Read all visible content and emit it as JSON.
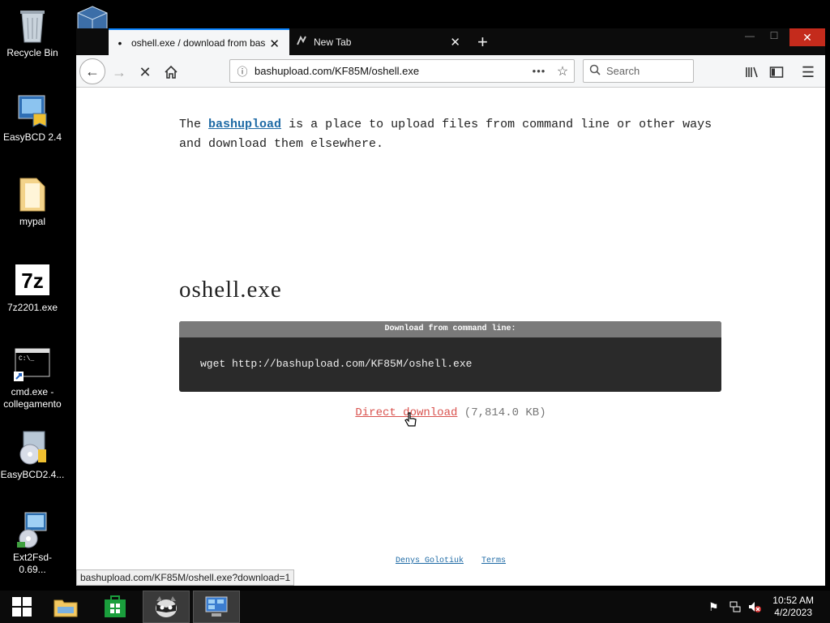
{
  "desktop": {
    "icons": [
      {
        "label": "Recycle Bin",
        "icon": "recycle-bin-icon"
      },
      {
        "label": "EasyBCD 2.4",
        "icon": "easybcd-icon"
      },
      {
        "label": "mypal",
        "icon": "folder-icon"
      },
      {
        "label": "7z2201.exe",
        "icon": "7zip-icon"
      },
      {
        "label": "cmd.exe - collegamento",
        "icon": "cmd-icon"
      },
      {
        "label": "EasyBCD2.4...",
        "icon": "installer-icon"
      },
      {
        "label": "Ext2Fsd-0.69...",
        "icon": "ext2fsd-icon"
      }
    ]
  },
  "browser": {
    "tabs": [
      {
        "label": "oshell.exe / download from bas",
        "active": true
      },
      {
        "label": "New Tab",
        "active": false
      }
    ],
    "url": "bashupload.com/KF85M/oshell.exe",
    "search_placeholder": "Search",
    "status_url": "bashupload.com/KF85M/oshell.exe?download=1"
  },
  "page": {
    "intro_prefix": "The",
    "intro_link": "bashupload",
    "intro_suffix": "is a place to upload files from command line or other ways and download them elsewhere.",
    "filename": "oshell.exe",
    "cmd_header": "Download from command line:",
    "cmd": "wget http://bashupload.com/KF85M/oshell.exe",
    "direct_download": "Direct download",
    "size": "(7,814.0 KB)",
    "footer_author": "Denys Golotiuk",
    "footer_terms": "Terms"
  },
  "taskbar": {
    "time": "10:52 AM",
    "date": "4/2/2023"
  },
  "colors": {
    "accent": "#0a84ff",
    "link": "#1e6aa5",
    "download_link": "#d9534f",
    "close_button": "#c42b1c"
  }
}
